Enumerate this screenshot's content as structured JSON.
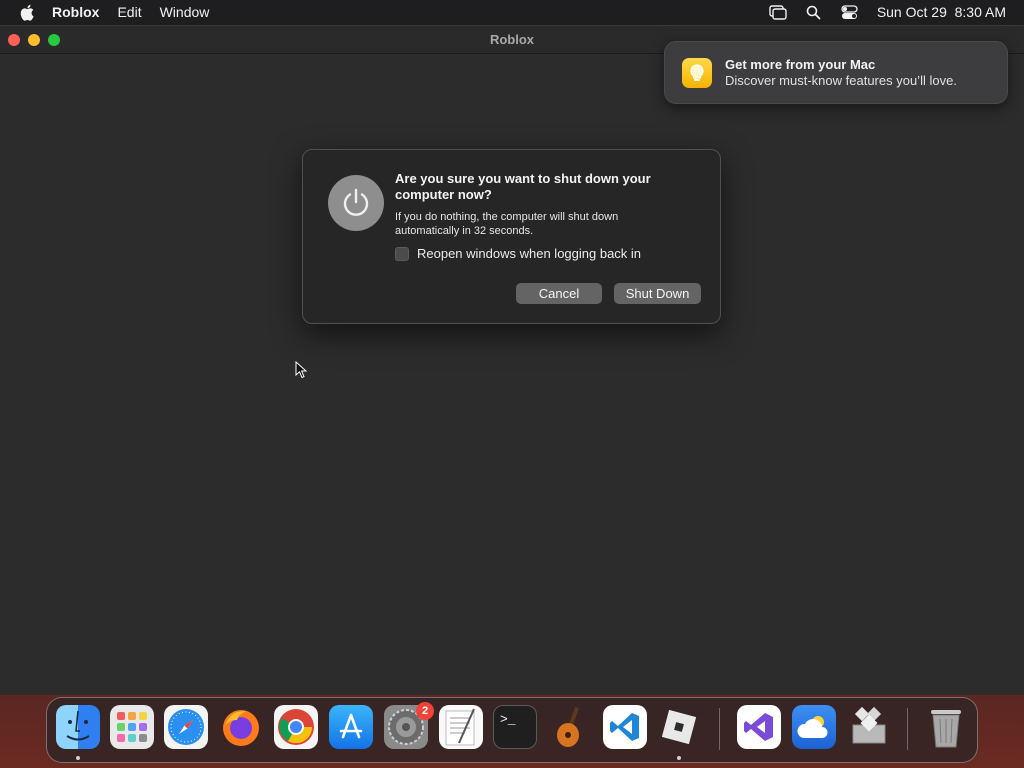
{
  "menubar": {
    "app_name": "Roblox",
    "menus": [
      "Edit",
      "Window"
    ],
    "datetime": "Sun Oct 29  8:30 AM",
    "icons": [
      "apple-logo-icon",
      "screen-mirroring-icon",
      "spotlight-search-icon",
      "control-center-icon"
    ]
  },
  "window": {
    "title": "Roblox"
  },
  "notification": {
    "title": "Get more from your Mac",
    "body": "Discover must-know features you’ll love.",
    "icon": "lightbulb-icon"
  },
  "dialog": {
    "title": "Are you sure you want to shut down your computer now?",
    "body": "If you do nothing, the computer will shut down automatically in 32 seconds.",
    "checkbox_label": "Reopen windows when logging back in",
    "checkbox_checked": false,
    "cancel_label": "Cancel",
    "shutdown_label": "Shut Down",
    "icon": "power-icon"
  },
  "dock": {
    "apps": [
      {
        "name": "Finder",
        "icon": "finder-icon",
        "running": true
      },
      {
        "name": "Launchpad",
        "icon": "launchpad-icon",
        "running": false
      },
      {
        "name": "Safari",
        "icon": "safari-icon",
        "running": false
      },
      {
        "name": "Firefox",
        "icon": "firefox-icon",
        "running": false
      },
      {
        "name": "Chrome",
        "icon": "chrome-icon",
        "running": false
      },
      {
        "name": "App Store",
        "icon": "app-store-icon",
        "running": false
      },
      {
        "name": "System Settings",
        "icon": "system-settings-icon",
        "running": false,
        "badge": "2"
      },
      {
        "name": "TextEdit",
        "icon": "textedit-icon",
        "running": false
      },
      {
        "name": "Terminal",
        "icon": "terminal-icon",
        "running": false
      },
      {
        "name": "GarageBand",
        "icon": "garageband-icon",
        "running": false
      },
      {
        "name": "Visual Studio Code",
        "icon": "vscode-icon",
        "running": false
      },
      {
        "name": "Roblox",
        "icon": "roblox-icon",
        "running": true
      },
      {
        "name": "Visual Studio",
        "icon": "visual-studio-icon",
        "running": false
      },
      {
        "name": "Weather",
        "icon": "weather-icon",
        "running": false
      },
      {
        "name": "Boot Camp Assistant",
        "icon": "bootcamp-icon",
        "running": false
      },
      {
        "name": "Trash",
        "icon": "trash-icon",
        "running": false
      }
    ],
    "terminal_glyph": ">_"
  },
  "colors": {
    "accent_red": "#fe5f57",
    "accent_yellow": "#febc2e",
    "accent_green": "#28c840",
    "badge_red": "#f0433a"
  }
}
